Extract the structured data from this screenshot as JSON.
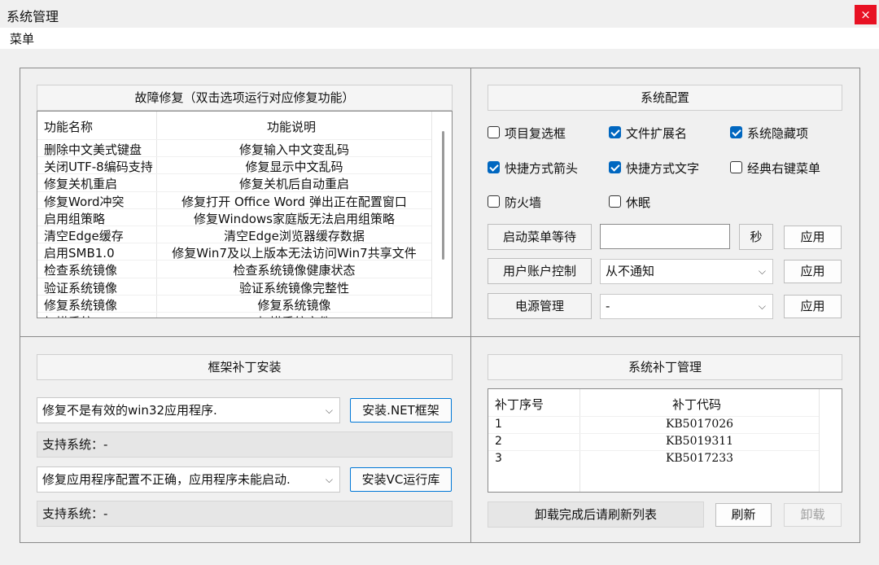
{
  "window": {
    "title": "系统管理",
    "close_label": "×"
  },
  "menu": {
    "item": "菜单"
  },
  "repair": {
    "header": "故障修复（双击选项运行对应修复功能）",
    "col_name": "功能名称",
    "col_desc": "功能说明",
    "rows": [
      {
        "name": "删除中文美式键盘",
        "desc": "修复输入中文变乱码"
      },
      {
        "name": "关闭UTF-8编码支持",
        "desc": "修复显示中文乱码"
      },
      {
        "name": "修复关机重启",
        "desc": "修复关机后自动重启"
      },
      {
        "name": "修复Word冲突",
        "desc": "修复打开 Office Word 弹出正在配置窗口"
      },
      {
        "name": "启用组策略",
        "desc": "修复Windows家庭版无法启用组策略"
      },
      {
        "name": "清空Edge缓存",
        "desc": "清空Edge浏览器缓存数据"
      },
      {
        "name": "启用SMB1.0",
        "desc": "修复Win7及以上版本无法访问Win7共享文件"
      },
      {
        "name": "检查系统镜像",
        "desc": "检查系统镜像健康状态"
      },
      {
        "name": "验证系统镜像",
        "desc": "验证系统镜像完整性"
      },
      {
        "name": "修复系统镜像",
        "desc": "修复系统镜像"
      },
      {
        "name": "扫描系统",
        "desc": "扫描系统文件"
      }
    ]
  },
  "config": {
    "header": "系统配置",
    "checks": [
      {
        "label": "项目复选框",
        "checked": false
      },
      {
        "label": "文件扩展名",
        "checked": true
      },
      {
        "label": "系统隐藏项",
        "checked": true
      },
      {
        "label": "快捷方式箭头",
        "checked": true
      },
      {
        "label": "快捷方式文字",
        "checked": true
      },
      {
        "label": "经典右键菜单",
        "checked": false
      },
      {
        "label": "防火墙",
        "checked": false
      },
      {
        "label": "休眠",
        "checked": false
      }
    ],
    "startup_wait": {
      "label": "启动菜单等待",
      "value": "",
      "unit": "秒",
      "apply": "应用"
    },
    "uac": {
      "label": "用户账户控制",
      "value": "从不通知",
      "apply": "应用"
    },
    "power": {
      "label": "电源管理",
      "value": "-",
      "apply": "应用"
    }
  },
  "framework": {
    "header": "框架补丁安装",
    "net_select": "修复不是有效的win32应用程序.",
    "net_button": "安装.NET框架",
    "net_support": "支持系统：-",
    "vc_select": "修复应用程序配置不正确，应用程序未能启动.",
    "vc_button": "安装VC运行库",
    "vc_support": "支持系统：-"
  },
  "patches": {
    "header": "系统补丁管理",
    "col_seq": "补丁序号",
    "col_code": "补丁代码",
    "rows": [
      {
        "seq": "1",
        "code": "KB5017026"
      },
      {
        "seq": "2",
        "code": "KB5019311"
      },
      {
        "seq": "3",
        "code": "KB5017233"
      }
    ],
    "status": "卸载完成后请刷新列表",
    "refresh": "刷新",
    "uninstall": "卸载"
  }
}
